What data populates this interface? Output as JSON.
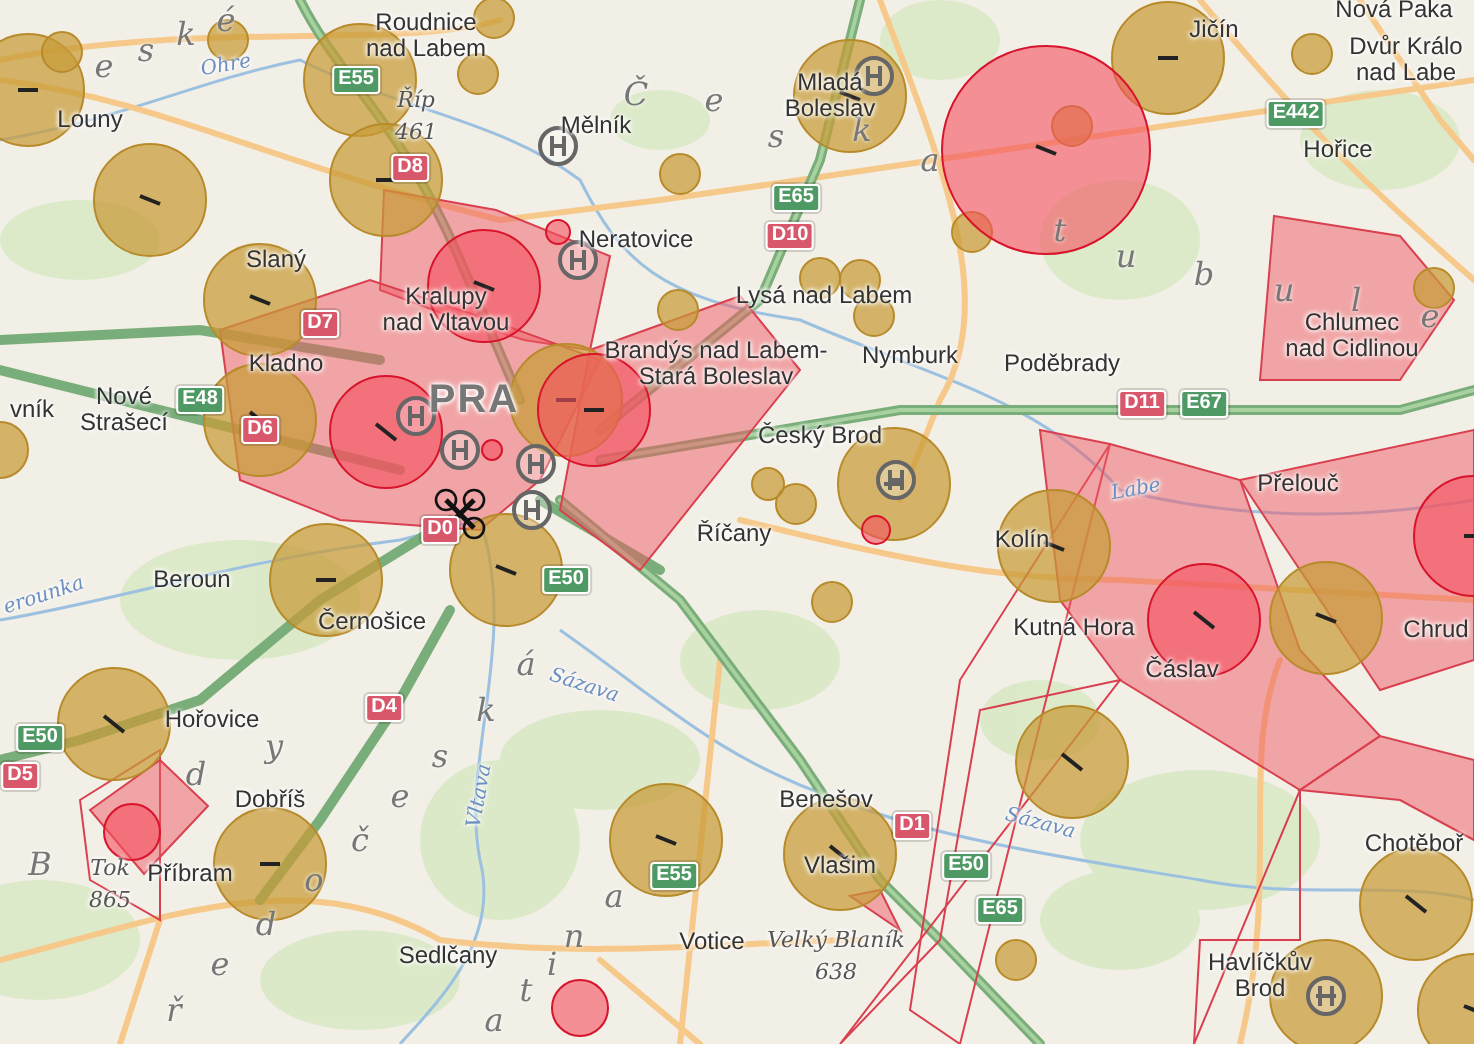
{
  "map": {
    "places": [
      {
        "lines": [
          "Roudnice",
          "nad Labem"
        ]
      },
      {
        "lines": [
          "Louny"
        ]
      },
      {
        "lines": [
          "Mělník"
        ]
      },
      {
        "lines": [
          "Neratovice"
        ]
      },
      {
        "lines": [
          "Slaný"
        ]
      },
      {
        "lines": [
          "Kralupy",
          "nad Vltavou"
        ]
      },
      {
        "lines": [
          "Kladno"
        ]
      },
      {
        "lines": [
          "vník"
        ]
      },
      {
        "lines": [
          "Nové",
          "Strašecí"
        ]
      },
      {
        "lines": [
          "Brandýs nad Labem-",
          "Stará Boleslav"
        ]
      },
      {
        "lines": [
          "PRA"
        ],
        "kind": "capital"
      },
      {
        "lines": [
          "Mladá",
          "Boleslav"
        ]
      },
      {
        "lines": [
          "Jičín"
        ]
      },
      {
        "lines": [
          "Nová Paka"
        ]
      },
      {
        "lines": [
          "Dvůr Králo",
          "nad Labe"
        ]
      },
      {
        "lines": [
          "Hořice"
        ]
      },
      {
        "lines": [
          "Lysá nad Labem"
        ]
      },
      {
        "lines": [
          "Nymburk"
        ]
      },
      {
        "lines": [
          "Poděbrady"
        ]
      },
      {
        "lines": [
          "Chlumec",
          "nad Cidlinou"
        ]
      },
      {
        "lines": [
          "Český Brod"
        ]
      },
      {
        "lines": [
          "Říčany"
        ]
      },
      {
        "lines": [
          "Přelouč"
        ]
      },
      {
        "lines": [
          "Kolín"
        ]
      },
      {
        "lines": [
          "Kutná Hora"
        ]
      },
      {
        "lines": [
          "Čáslav"
        ]
      },
      {
        "lines": [
          "Chrud"
        ]
      },
      {
        "lines": [
          "Beroun"
        ]
      },
      {
        "lines": [
          "Černošice"
        ]
      },
      {
        "lines": [
          "Hořovice"
        ]
      },
      {
        "lines": [
          "Dobříš"
        ]
      },
      {
        "lines": [
          "Příbram"
        ]
      },
      {
        "lines": [
          "Benešov"
        ]
      },
      {
        "lines": [
          "Vlašim"
        ]
      },
      {
        "lines": [
          "Sedlčany"
        ]
      },
      {
        "lines": [
          "Votice"
        ]
      },
      {
        "lines": [
          "Chotěboř"
        ]
      },
      {
        "lines": [
          "Havlíčkův",
          "Brod"
        ]
      }
    ],
    "peaks": [
      {
        "name": "Říp",
        "elevation": "461"
      },
      {
        "name": "Tok",
        "elevation": "865"
      },
      {
        "name": "Velký Blaník",
        "elevation": "638"
      }
    ],
    "rivers": [
      "Ohre",
      "erounka",
      "Sázava",
      "Vltava",
      "Sázava",
      "Labe"
    ],
    "road_shields": [
      {
        "label": "E55",
        "kind": "european"
      },
      {
        "label": "D8",
        "kind": "motorway"
      },
      {
        "label": "D7",
        "kind": "motorway"
      },
      {
        "label": "D6",
        "kind": "motorway"
      },
      {
        "label": "E48",
        "kind": "european"
      },
      {
        "label": "D0",
        "kind": "motorway"
      },
      {
        "label": "D10",
        "kind": "motorway"
      },
      {
        "label": "E65",
        "kind": "european"
      },
      {
        "label": "E442",
        "kind": "european"
      },
      {
        "label": "D11",
        "kind": "motorway"
      },
      {
        "label": "E67",
        "kind": "european"
      },
      {
        "label": "E50",
        "kind": "european"
      },
      {
        "label": "D4",
        "kind": "motorway"
      },
      {
        "label": "E50",
        "kind": "european"
      },
      {
        "label": "D5",
        "kind": "motorway"
      },
      {
        "label": "E55",
        "kind": "european"
      },
      {
        "label": "D1",
        "kind": "motorway"
      },
      {
        "label": "E50",
        "kind": "european"
      },
      {
        "label": "E65",
        "kind": "european"
      }
    ],
    "region_letters": [
      "e",
      "s",
      "k",
      "é",
      "Č",
      "e",
      "s",
      "k",
      "a",
      "t",
      "u",
      "b",
      "u",
      "l",
      "e",
      "y",
      "d",
      "B",
      "o",
      "d",
      "e",
      "ř",
      "č",
      "e",
      "s",
      "k",
      "á",
      "a",
      "n",
      "i",
      "t",
      "a"
    ]
  }
}
